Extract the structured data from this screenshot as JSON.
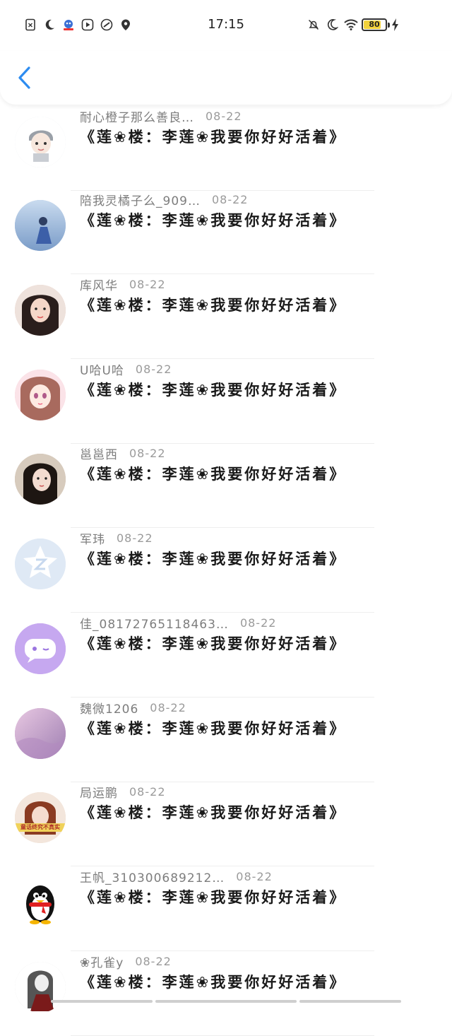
{
  "status_bar": {
    "time": "17:15",
    "battery": "80",
    "battery_level": 0.8,
    "left_icons": [
      "sim-off-icon",
      "do-not-disturb-moon-icon",
      "app-badge-icon",
      "video-app-icon",
      "link-app-icon",
      "location-pin-icon"
    ],
    "right_icons": [
      "notifications-off-icon",
      "moon-icon",
      "wifi-icon",
      "battery-icon",
      "charging-bolt-icon"
    ]
  },
  "header": {
    "back_icon": "chevron-left-icon",
    "accent_color": "#2d8cf0"
  },
  "comments": [
    {
      "name": "耐心橙子那么善良…",
      "date": "08-22",
      "text": "《莲❀楼：李莲❀我要你好好活着》",
      "avatar": "cartoon-boy",
      "avatar_color": "#d8dde4"
    },
    {
      "name": "陪我灵橘子么_909…",
      "date": "08-22",
      "text": "《莲❀楼：李莲❀我要你好好活着》",
      "avatar": "blue-landscape",
      "avatar_color": "#9fb8d8"
    },
    {
      "name": "库风华",
      "date": "08-22",
      "text": "《莲❀楼：李莲❀我要你好好活着》",
      "avatar": "girl-photo",
      "avatar_color": "#e7c3b5"
    },
    {
      "name": "U哈U哈",
      "date": "08-22",
      "text": "《莲❀楼：李莲❀我要你好好活着》",
      "avatar": "anime-girl-pink",
      "avatar_color": "#f3c6cf"
    },
    {
      "name": "邕邕西",
      "date": "08-22",
      "text": "《莲❀楼：李莲❀我要你好好活着》",
      "avatar": "woman-photo",
      "avatar_color": "#c9b5a3"
    },
    {
      "name": "军玮",
      "date": "08-22",
      "text": "《莲❀楼：李莲❀我要你好好活着》",
      "avatar": "default-star",
      "avatar_color": "#dfe9f5"
    },
    {
      "name": "佳_08172765118463…",
      "date": "08-22",
      "text": "《莲❀楼：李莲❀我要你好好活着》",
      "avatar": "chat-bubble-purple",
      "avatar_color": "#c6a8f0"
    },
    {
      "name": "魏微1206",
      "date": "08-22",
      "text": "《莲❀楼：李莲❀我要你好好活着》",
      "avatar": "pink-sky",
      "avatar_color": "#c9a4c8"
    },
    {
      "name": "局运鹏",
      "date": "08-22",
      "text": "《莲❀楼：李莲❀我要你好好活着》",
      "avatar": "fairy-tale-banner",
      "avatar_color": "#e9d3c3",
      "avatar_text": "童话终究不真实"
    },
    {
      "name": "王帆_310300689212…",
      "date": "08-22",
      "text": "《莲❀楼：李莲❀我要你好好活着》",
      "avatar": "qq-penguin",
      "avatar_color": "#ffffff"
    },
    {
      "name": "❀孔雀y",
      "date": "08-22",
      "text": "《莲❀楼：李莲❀我要你好好活着》",
      "avatar": "gothic-girl",
      "avatar_color": "#d7d7d7"
    }
  ]
}
